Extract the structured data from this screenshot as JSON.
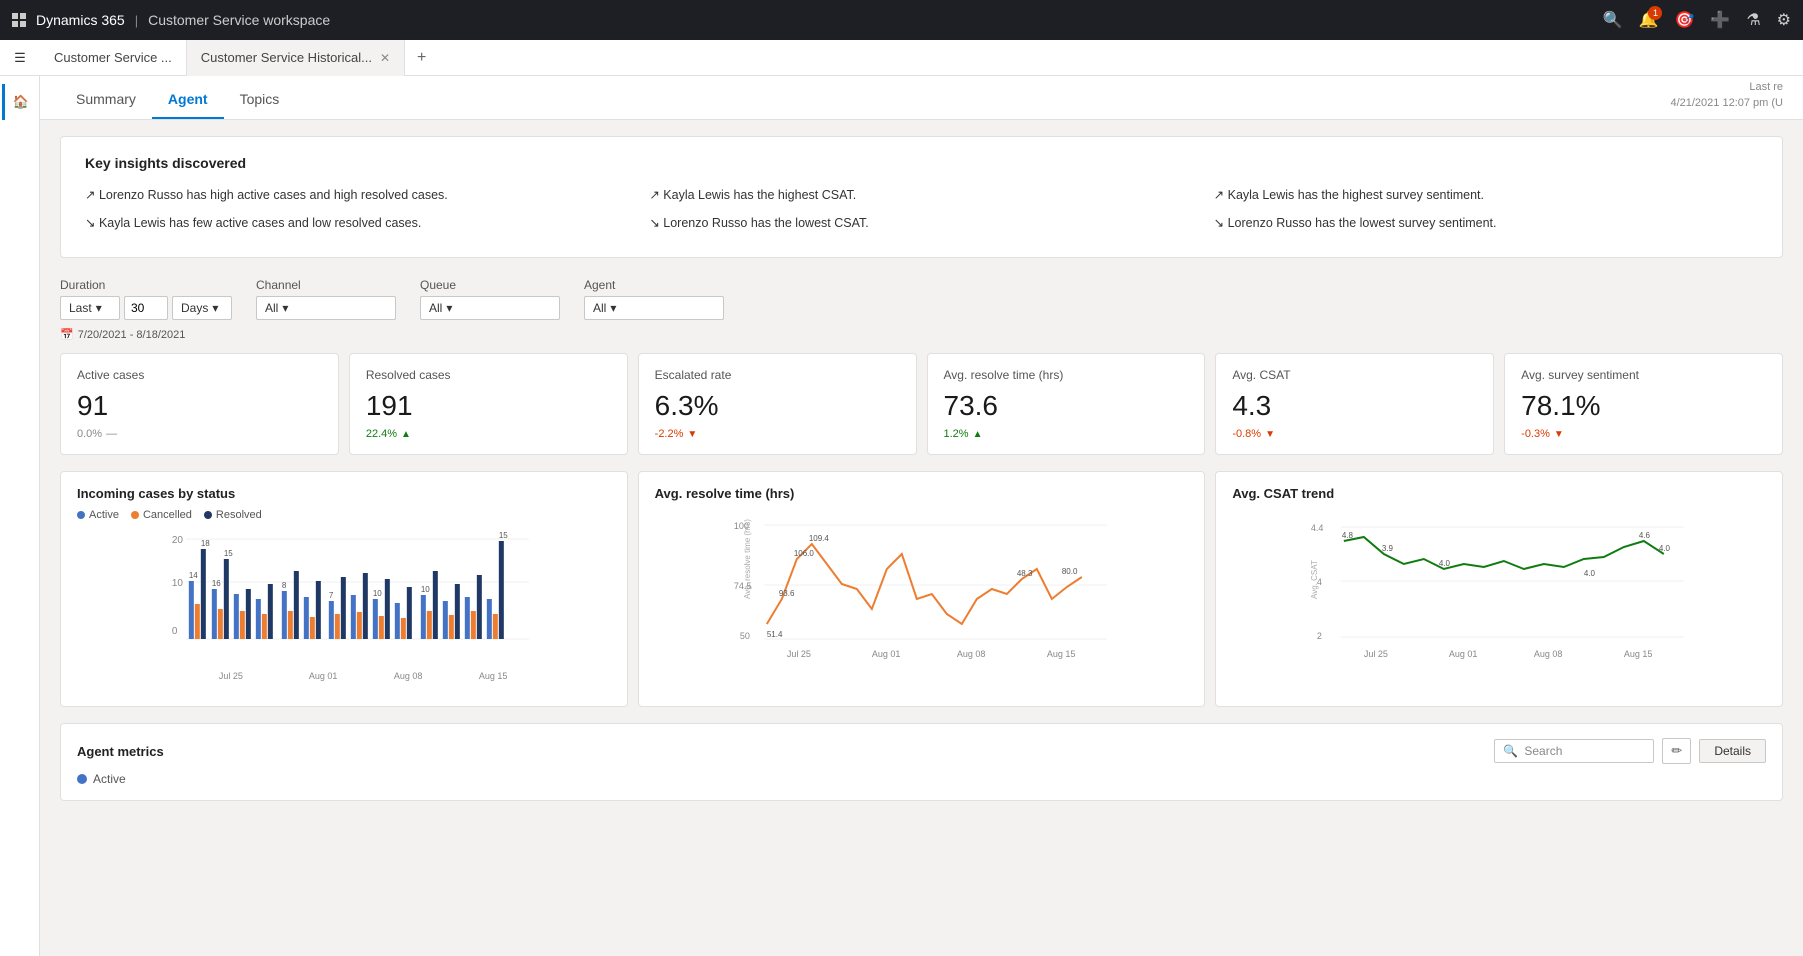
{
  "app": {
    "brand": "Dynamics 365",
    "separator": "|",
    "workspace_title": "Customer Service workspace"
  },
  "tabs": [
    {
      "id": "customer-service",
      "label": "Customer Service ...",
      "active": false,
      "closable": false
    },
    {
      "id": "historical",
      "label": "Customer Service Historical...",
      "active": true,
      "closable": true
    }
  ],
  "sub_nav": {
    "tabs": [
      {
        "id": "summary",
        "label": "Summary",
        "active": false
      },
      {
        "id": "agent",
        "label": "Agent",
        "active": true
      },
      {
        "id": "topics",
        "label": "Topics",
        "active": false
      }
    ],
    "last_refresh_label": "Last re",
    "last_refresh_time": "4/21/2021 12:07 pm (U"
  },
  "insights": {
    "title": "Key insights discovered",
    "items": [
      {
        "type": "up",
        "text": "Lorenzo Russo has high active cases and high resolved cases."
      },
      {
        "type": "up",
        "text": "Kayla Lewis has the highest CSAT."
      },
      {
        "type": "up",
        "text": "Kayla Lewis has the highest survey sentiment."
      },
      {
        "type": "down",
        "text": "Kayla Lewis has few active cases and low resolved cases."
      },
      {
        "type": "down",
        "text": "Lorenzo Russo has the lowest CSAT."
      },
      {
        "type": "down",
        "text": "Lorenzo Russo has the lowest survey sentiment."
      }
    ]
  },
  "filters": {
    "duration": {
      "label": "Duration",
      "type_value": "Last",
      "amount_value": "30",
      "unit_value": "Days"
    },
    "channel": {
      "label": "Channel",
      "value": "All"
    },
    "queue": {
      "label": "Queue",
      "value": "All"
    },
    "agent": {
      "label": "Agent",
      "value": "All"
    },
    "date_range": "7/20/2021 - 8/18/2021"
  },
  "kpis": [
    {
      "id": "active-cases",
      "label": "Active cases",
      "value": "91",
      "change": "0.0%",
      "change_type": "neutral",
      "indicator": "dash"
    },
    {
      "id": "resolved-cases",
      "label": "Resolved cases",
      "value": "191",
      "change": "22.4%",
      "change_type": "up",
      "indicator": "up"
    },
    {
      "id": "escalated-rate",
      "label": "Escalated rate",
      "value": "6.3%",
      "change": "-2.2%",
      "change_type": "down",
      "indicator": "down"
    },
    {
      "id": "avg-resolve-time",
      "label": "Avg. resolve time (hrs)",
      "value": "73.6",
      "change": "1.2%",
      "change_type": "up",
      "indicator": "up"
    },
    {
      "id": "avg-csat",
      "label": "Avg. CSAT",
      "value": "4.3",
      "change": "-0.8%",
      "change_type": "down",
      "indicator": "down"
    },
    {
      "id": "avg-survey",
      "label": "Avg. survey sentiment",
      "value": "78.1%",
      "change": "-0.3%",
      "change_type": "down",
      "indicator": "down"
    }
  ],
  "charts": {
    "incoming_cases": {
      "title": "Incoming cases by status",
      "legend": [
        {
          "label": "Active",
          "color": "#4472c4"
        },
        {
          "label": "Cancelled",
          "color": "#ed7d31"
        },
        {
          "label": "Resolved",
          "color": "#1f3864"
        }
      ]
    },
    "avg_resolve_time": {
      "title": "Avg. resolve time (hrs)",
      "y_labels": [
        "100",
        "74.5",
        "50"
      ],
      "x_labels": [
        "Jul 25",
        "Aug 01",
        "Aug 08",
        "Aug 15"
      ],
      "peak_labels": [
        "106.0",
        "109.4",
        "93.6",
        "51.4",
        "80.0",
        "48.3"
      ]
    },
    "avg_csat_trend": {
      "title": "Avg. CSAT trend",
      "y_labels": [
        "4.4",
        "4",
        "2"
      ],
      "x_labels": [
        "Jul 25",
        "Aug 01",
        "Aug 08",
        "Aug 15"
      ],
      "data_labels": [
        "4.8",
        "3.9",
        "4.0",
        "4.0",
        "4.6",
        "4.0"
      ]
    }
  },
  "agent_metrics": {
    "title": "Agent metrics",
    "search_placeholder": "Search",
    "details_label": "Details",
    "active_label": "Active"
  }
}
